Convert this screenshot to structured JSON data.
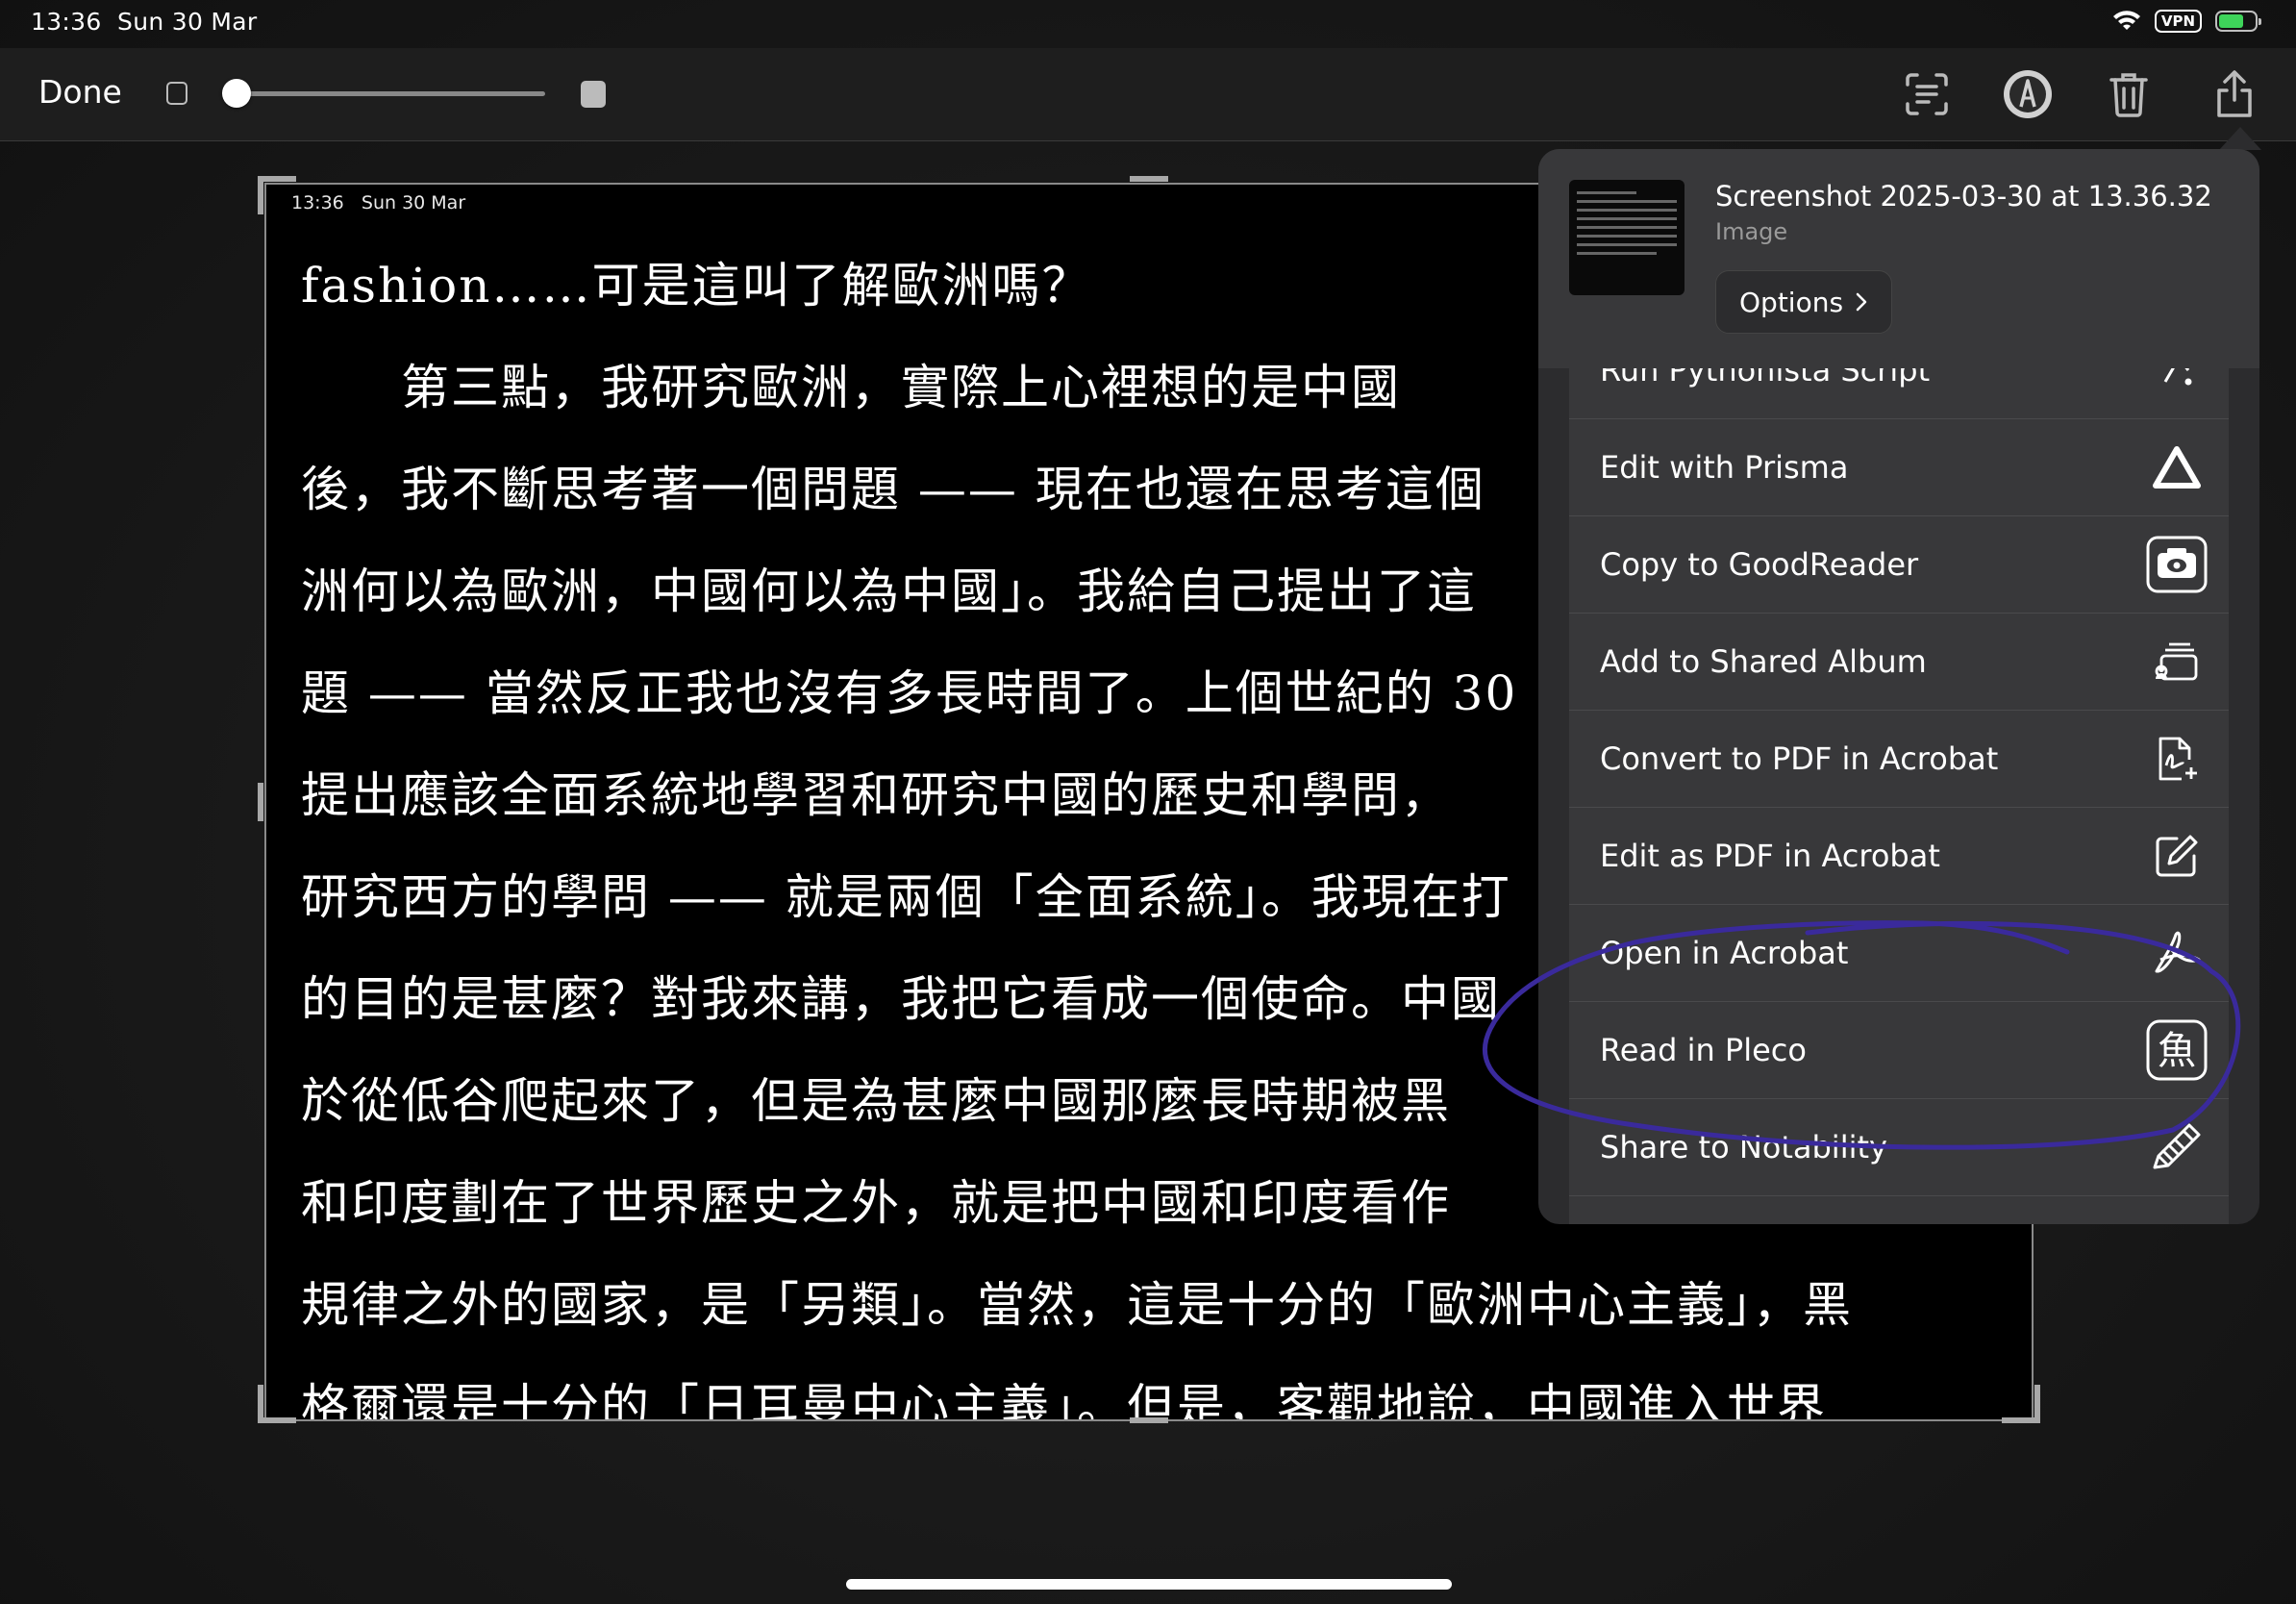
{
  "status_bar": {
    "time": "13:36",
    "date": "Sun 30 Mar",
    "vpn": "VPN",
    "battery_level": 0.7
  },
  "toolbar": {
    "done_label": "Done",
    "size_slider_value": 0.0
  },
  "preview": {
    "status_time": "13:36",
    "status_date": "Sun 30 Mar",
    "lines": [
      "fashion……可是這叫了解歐洲嗎？",
      "　　第三點，我研究歐洲，實際上心裡想的是中國",
      "後，我不斷思考著一個問題 —— 現在也還在思考這個",
      "洲何以為歐洲，中國何以為中國」。我給自己提出了這",
      "題 —— 當然反正我也沒有多長時間了。上個世紀的 30",
      "提出應該全面系統地學習和研究中國的歷史和學問，",
      "研究西方的學問 —— 就是兩個「全面系統」。我現在打",
      "的目的是甚麼？對我來講，我把它看成一個使命。中國",
      "於從低谷爬起來了，但是為甚麼中國那麼長時期被黑",
      "和印度劃在了世界歷史之外，就是把中國和印度看作",
      "規律之外的國家，是「另類」。當然，這是十分的「歐洲中心主義」，黑",
      "格爾還是十分的「日耳曼中心主義」。但是，客觀地說，中國進入世界"
    ]
  },
  "share_sheet": {
    "file_title": "Screenshot 2025-03-30 at 13.36.32",
    "file_type": "Image",
    "options_label": "Options",
    "partial_row_label": "Run Pythonista Script",
    "actions": [
      {
        "label": "Edit with Prisma",
        "icon": "prisma-icon"
      },
      {
        "label": "Copy to GoodReader",
        "icon": "goodreader-icon"
      },
      {
        "label": "Add to Shared Album",
        "icon": "shared-album-icon"
      },
      {
        "label": "Convert to PDF in Acrobat",
        "icon": "pdf-convert-icon"
      },
      {
        "label": "Edit as PDF in Acrobat",
        "icon": "pdf-edit-icon"
      },
      {
        "label": "Open in Acrobat",
        "icon": "acrobat-icon"
      },
      {
        "label": "Read in Pleco",
        "icon": "pleco-icon"
      },
      {
        "label": "Share to Notability",
        "icon": "pencil-icon"
      }
    ]
  },
  "colors": {
    "annotation_stroke": "#3a2a9c",
    "sheet_background": "#2c2c2e",
    "row_background": "#38383a"
  }
}
